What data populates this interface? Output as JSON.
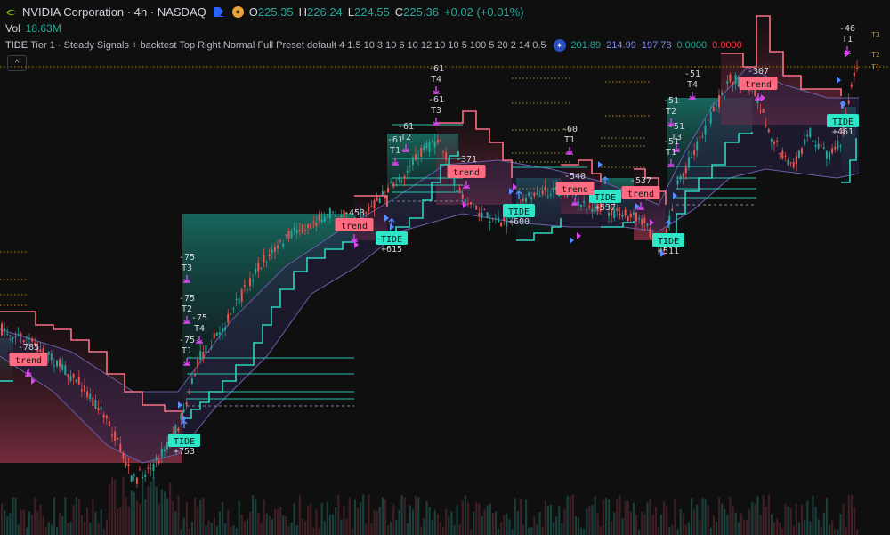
{
  "symbol": {
    "name": "NVIDIA Corporation",
    "timeframe": "4h",
    "exchange": "NASDAQ",
    "sep": "·"
  },
  "ohlc": {
    "o_label": "O",
    "o": "225.35",
    "h_label": "H",
    "h": "226.24",
    "l_label": "L",
    "l": "224.55",
    "c_label": "C",
    "c": "225.36",
    "change": "+0.02 (+0.01%)"
  },
  "volume": {
    "label": "Vol",
    "value": "18.63M"
  },
  "indicator": {
    "name": "TIDE",
    "params": "Tier 1 · Steady Signals + backtest Top Right Normal Full Preset default 4 1.5 10 3 10 6 10 12 10 10 5 100 5 20 2 14 0.5",
    "values": [
      "201.89",
      "214.99",
      "197.78",
      "0.0000",
      "0.0000"
    ],
    "value_colors": [
      "#26a69a",
      "#7e8df0",
      "#7e8df0",
      "#26a69a",
      "#f23645"
    ]
  },
  "collapse_label": "^",
  "colors": {
    "up": "#26a69a",
    "down": "#ef5350",
    "bull_band": "#2dd4bf",
    "bear_band": "#f87185",
    "tide_badge": "#2ee6c8",
    "trend_badge": "#ff6b81",
    "arrow": "#d946ef",
    "channel": "#6b5ea8"
  },
  "chart_data": {
    "type": "candlestick",
    "signals": [
      {
        "kind": "tide",
        "label": "TIDE",
        "value": "+753"
      },
      {
        "kind": "tide",
        "label": "TIDE",
        "value": "+615"
      },
      {
        "kind": "tide",
        "label": "TIDE",
        "value": "+600"
      },
      {
        "kind": "tide",
        "label": "TIDE",
        "value": "+537"
      },
      {
        "kind": "tide",
        "label": "TIDE",
        "value": "+511"
      },
      {
        "kind": "tide",
        "label": "TIDE",
        "value": "+461"
      },
      {
        "kind": "trend",
        "label": "trend",
        "value": "-785"
      },
      {
        "kind": "trend",
        "label": "trend",
        "value": "-453"
      },
      {
        "kind": "trend",
        "label": "trend",
        "value": "-371"
      },
      {
        "kind": "trend",
        "label": "trend",
        "value": "-540"
      },
      {
        "kind": "trend",
        "label": "trend",
        "value": "-537"
      },
      {
        "kind": "trend",
        "label": "trend",
        "value": "-307"
      }
    ],
    "targets": [
      {
        "value": "-75",
        "tier": "T3"
      },
      {
        "value": "-75",
        "tier": "T2"
      },
      {
        "value": "-75",
        "tier": "T4"
      },
      {
        "value": "-75",
        "tier": "T1"
      },
      {
        "value": "-61",
        "tier": "T4"
      },
      {
        "value": "-61",
        "tier": "T3"
      },
      {
        "value": "-61",
        "tier": "T2"
      },
      {
        "value": "-61",
        "tier": "T1"
      },
      {
        "value": "-60",
        "tier": "T1"
      },
      {
        "value": "-51",
        "tier": "T4"
      },
      {
        "value": "-51",
        "tier": "T2"
      },
      {
        "value": "-51",
        "tier": "T3"
      },
      {
        "value": "-51",
        "tier": "T1"
      },
      {
        "value": "-46",
        "tier": "T1"
      }
    ],
    "axis_marks": [
      "T3",
      "T2",
      "T1"
    ]
  }
}
